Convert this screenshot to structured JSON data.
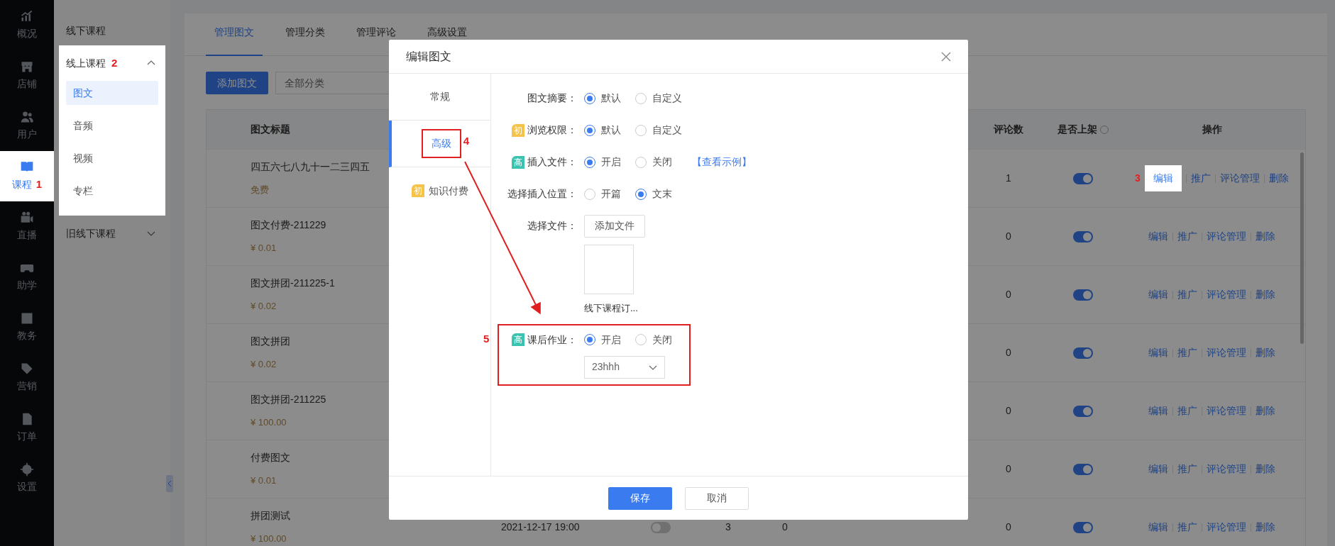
{
  "sidebar": {
    "items": [
      {
        "label": "概况",
        "selected": false
      },
      {
        "label": "店铺",
        "selected": false
      },
      {
        "label": "用户",
        "selected": false
      },
      {
        "label": "课程",
        "selected": true,
        "callout": "1"
      },
      {
        "label": "直播",
        "selected": false
      },
      {
        "label": "助学",
        "selected": false
      },
      {
        "label": "教务",
        "selected": false
      },
      {
        "label": "营销",
        "selected": false
      },
      {
        "label": "订单",
        "selected": false
      },
      {
        "label": "设置",
        "selected": false
      }
    ]
  },
  "submenu": {
    "items": [
      {
        "kind": "link",
        "label": "线下课程"
      },
      {
        "kind": "group",
        "label": "线上课程",
        "expanded": true,
        "callout": "2",
        "children": [
          {
            "label": "图文",
            "selected": true
          },
          {
            "label": "音频",
            "selected": false
          },
          {
            "label": "视频",
            "selected": false
          },
          {
            "label": "专栏",
            "selected": false
          }
        ]
      },
      {
        "kind": "group",
        "label": "旧线下课程",
        "expanded": false
      }
    ]
  },
  "tabs": [
    {
      "label": "管理图文",
      "selected": true
    },
    {
      "label": "管理分类",
      "selected": false
    },
    {
      "label": "管理评论",
      "selected": false
    },
    {
      "label": "高级设置",
      "selected": false
    }
  ],
  "toolbar": {
    "add_button": "添加图文",
    "category_select": "全部分类"
  },
  "table": {
    "columns": {
      "title": "图文标题",
      "comments": "评论数",
      "on_shelf": "是否上架",
      "actions": "操作"
    },
    "rows": [
      {
        "title": "四五六七八九十一二三四五",
        "price": "免费",
        "comments": "1",
        "on_shelf": true,
        "actions": [
          "编辑",
          "推广",
          "评论管理",
          "删除"
        ],
        "callout": "3"
      },
      {
        "title": "图文付费-211229",
        "price": "¥ 0.01",
        "comments": "0",
        "on_shelf": true,
        "actions": [
          "编辑",
          "推广",
          "评论管理",
          "删除"
        ]
      },
      {
        "title": "图文拼团-211225-1",
        "price": "¥ 0.02",
        "comments": "0",
        "on_shelf": true,
        "actions": [
          "编辑",
          "推广",
          "评论管理",
          "删除"
        ]
      },
      {
        "title": "图文拼团",
        "price": "¥ 0.02",
        "comments": "0",
        "on_shelf": true,
        "actions": [
          "编辑",
          "推广",
          "评论管理",
          "删除"
        ]
      },
      {
        "title": "图文拼团-211225",
        "price": "¥ 100.00",
        "comments": "0",
        "on_shelf": true,
        "actions": [
          "编辑",
          "推广",
          "评论管理",
          "删除"
        ]
      },
      {
        "title": "付费图文",
        "price": "¥ 0.01",
        "comments": "0",
        "on_shelf": true,
        "actions": [
          "编辑",
          "推广",
          "评论管理",
          "删除"
        ]
      },
      {
        "title": "拼团测试",
        "price": "¥ 100.00",
        "comments": "0",
        "on_shelf": true,
        "actions": [
          "编辑",
          "推广",
          "评论管理",
          "删除"
        ],
        "column_3": "2021-12-17 19:00",
        "column_5_on": false,
        "column_6": "3",
        "column_7": "0"
      }
    ]
  },
  "dialog": {
    "title": "编辑图文",
    "nav": [
      {
        "label": "常规",
        "selected": false
      },
      {
        "label": "高级",
        "selected": true,
        "callout": "4"
      },
      {
        "label": "知识付费",
        "selected": false,
        "badge": {
          "text": "初",
          "kind": "basic"
        }
      }
    ],
    "rows": [
      {
        "kind": "radio",
        "label": "图文摘要：",
        "options": [
          {
            "label": "默认",
            "selected": true
          },
          {
            "label": "自定义",
            "selected": false
          }
        ]
      },
      {
        "kind": "radio",
        "label": "浏览权限：",
        "badge": {
          "text": "初",
          "kind": "basic"
        },
        "options": [
          {
            "label": "默认",
            "selected": true
          },
          {
            "label": "自定义",
            "selected": false
          }
        ]
      },
      {
        "kind": "radio",
        "label": "插入文件：",
        "badge": {
          "text": "高",
          "kind": "advanced"
        },
        "options": [
          {
            "label": "开启",
            "selected": true
          },
          {
            "label": "关闭",
            "selected": false
          }
        ],
        "link": "【查看示例】"
      },
      {
        "kind": "radio",
        "label": "选择插入位置：",
        "options": [
          {
            "label": "开篇",
            "selected": false
          },
          {
            "label": "文末",
            "selected": true
          }
        ]
      },
      {
        "kind": "file",
        "label": "选择文件：",
        "button": "添加文件",
        "file_name": "线下课程订..."
      },
      {
        "kind": "radio",
        "label": "课后作业：",
        "badge": {
          "text": "高",
          "kind": "advanced"
        },
        "options": [
          {
            "label": "开启",
            "selected": true
          },
          {
            "label": "关闭",
            "selected": false
          }
        ],
        "select": "23hhh",
        "callout": "5"
      }
    ],
    "buttons": [
      {
        "label": "保存",
        "kind": "primary"
      },
      {
        "label": "取消",
        "kind": "default"
      }
    ]
  }
}
